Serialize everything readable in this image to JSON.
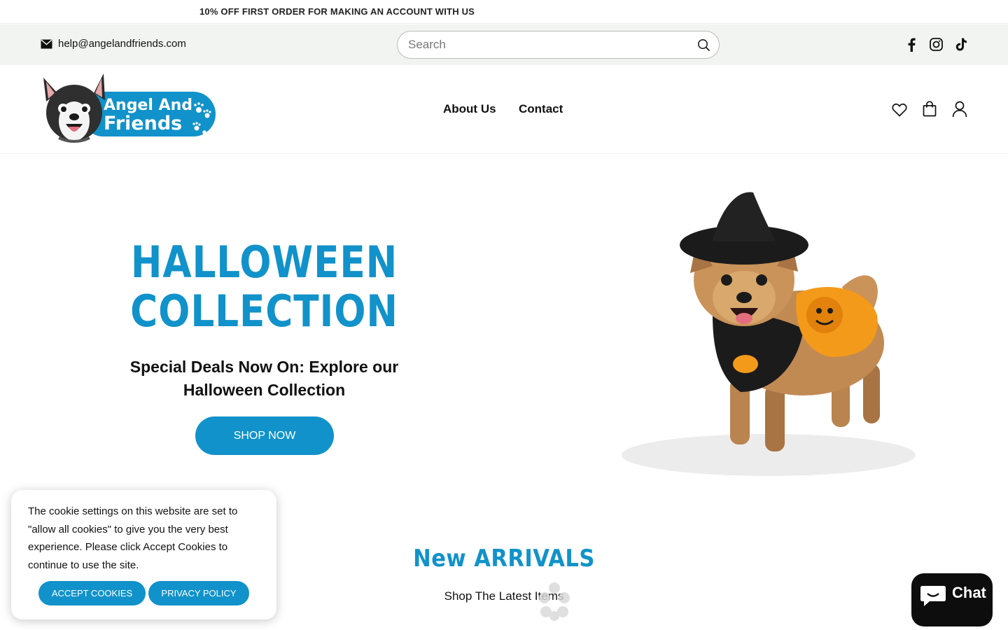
{
  "announcement": "10% OFF FIRST ORDER FOR MAKING AN ACCOUNT WITH US",
  "topbar": {
    "email": "help@angelandfriends.com",
    "search_placeholder": "Search"
  },
  "logo": {
    "line1": "Angel And",
    "line2": "Friends"
  },
  "nav": {
    "about": "About Us",
    "contact": "Contact"
  },
  "hero": {
    "title_line1": "HALLOWEEN",
    "title_line2": "COLLECTION",
    "subtitle_line1": "Special Deals Now On: Explore our",
    "subtitle_line2": "Halloween Collection",
    "button": "SHOP NOW"
  },
  "arrivals": {
    "title": "New ARRIVALS",
    "subtitle": "Shop The Latest Items"
  },
  "cookie": {
    "text": "The cookie settings on this website are set to \"allow all cookies\" to give you the very best experience. Please click Accept Cookies to continue to use the site.",
    "accept": "ACCEPT COOKIES",
    "privacy": "PRIVACY POLICY"
  },
  "chat": {
    "label": "Chat"
  },
  "colors": {
    "brand_blue": "#1192ca",
    "topbar_bg": "#f1f4f1",
    "chat_bg": "#0d0d0d"
  },
  "icons": [
    "mail-icon",
    "search-icon",
    "facebook-icon",
    "instagram-icon",
    "tiktok-icon",
    "heart-icon",
    "bag-icon",
    "account-icon",
    "chat-bubble-icon"
  ]
}
